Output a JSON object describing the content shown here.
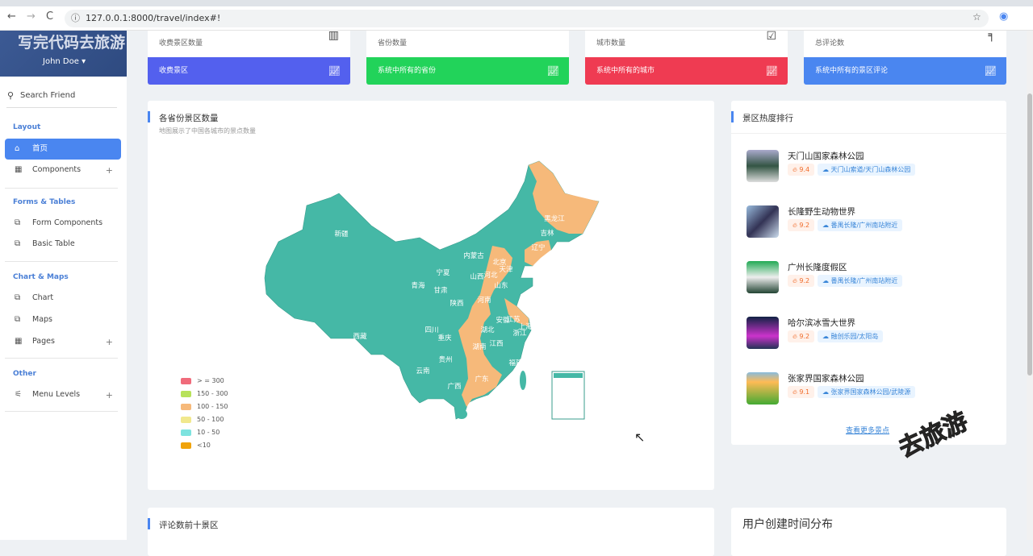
{
  "browser": {
    "url": "127.0.0.1:8000/travel/index#!",
    "back": "←",
    "forward": "→",
    "reload": "C",
    "info": "ⓘ"
  },
  "sidebar": {
    "watermark": "写完代码去旅游",
    "user": "John Doe ▾",
    "search_placeholder": "Search Friend",
    "sections": {
      "layout": "Layout",
      "forms": "Forms & Tables",
      "charts": "Chart & Maps",
      "other": "Other"
    },
    "items": [
      {
        "label": "首页"
      },
      {
        "label": "Components"
      },
      {
        "label": "Form Components"
      },
      {
        "label": "Basic Table"
      },
      {
        "label": "Chart"
      },
      {
        "label": "Maps"
      },
      {
        "label": "Pages"
      },
      {
        "label": "Menu Levels"
      }
    ]
  },
  "stats": [
    {
      "label": "收费景区数量",
      "footer": "收费景区",
      "color": "#5360ee"
    },
    {
      "label": "省份数量",
      "footer": "系统中所有的省份",
      "color": "#22d35a"
    },
    {
      "label": "城市数量",
      "footer": "系统中所有的城市",
      "color": "#ef3b52"
    },
    {
      "label": "总评论数",
      "footer": "系统中所有的景区评论",
      "color": "#4a86f0"
    }
  ],
  "map_card": {
    "title": "各省份景区数量",
    "subtitle": "地图展示了中国各城市的景点数量",
    "legend": [
      {
        "label": "> = 300",
        "color": "#f06b7b"
      },
      {
        "label": "150 - 300",
        "color": "#b7e25a"
      },
      {
        "label": "100 - 150",
        "color": "#f6b97a"
      },
      {
        "label": "50 - 100",
        "color": "#f1e88e"
      },
      {
        "label": "10 - 50",
        "color": "#7de3df"
      },
      {
        "label": "<10",
        "color": "#f0a30a"
      }
    ],
    "provinces": [
      "新疆",
      "西藏",
      "青海",
      "甘肃",
      "宁夏",
      "内蒙古",
      "陕西",
      "四川",
      "重庆",
      "贵州",
      "云南",
      "广西",
      "广东",
      "湖南",
      "湖北",
      "江西",
      "河南",
      "山西",
      "河北",
      "北京",
      "天津",
      "山东",
      "安徽",
      "江苏",
      "上海",
      "浙江",
      "福建",
      "辽宁",
      "吉林",
      "黑龙江"
    ]
  },
  "ranking": {
    "title": "景区热度排行",
    "more": "查看更多景点",
    "items": [
      {
        "name": "天门山国家森林公园",
        "score": "9.4",
        "location": "天门山索道/天门山森林公园"
      },
      {
        "name": "长隆野生动物世界",
        "score": "9.2",
        "location": "番禺长隆/广州南站附近"
      },
      {
        "name": "广州长隆度假区",
        "score": "9.2",
        "location": "番禺长隆/广州南站附近"
      },
      {
        "name": "哈尔滨冰雪大世界",
        "score": "9.2",
        "location": "融创乐园/太阳岛"
      },
      {
        "name": "张家界国家森林公园",
        "score": "9.1",
        "location": "张家界国家森林公园/武陵源"
      }
    ]
  },
  "bottom": {
    "left_title": "评论数前十景区",
    "right_title": "用户创建时间分布"
  },
  "sticker": "去旅游"
}
